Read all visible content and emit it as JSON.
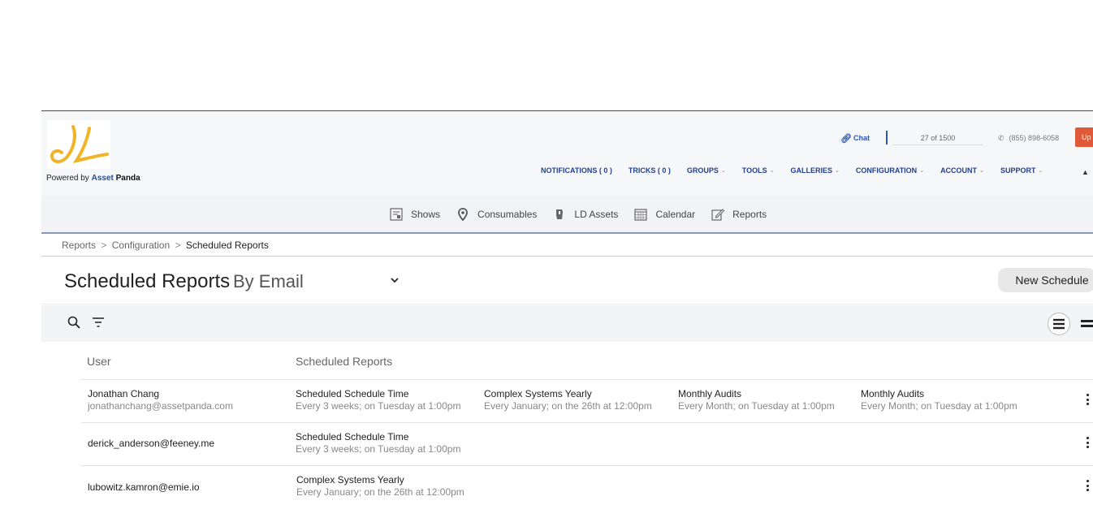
{
  "header": {
    "powered_prefix": "Powered by ",
    "powered_asset": "Asset",
    "powered_panda": "Panda",
    "chat_label": "Chat",
    "asset_count": "27 of 1500",
    "phone": "(855) 898-6058",
    "upgrade_label": "Up",
    "nav": [
      {
        "label": "NOTIFICATIONS ( 0 )",
        "has_menu": false
      },
      {
        "label": "TRICKS ( 0 )",
        "has_menu": false
      },
      {
        "label": "GROUPS",
        "has_menu": true
      },
      {
        "label": "TOOLS",
        "has_menu": true
      },
      {
        "label": "GALLERIES",
        "has_menu": true
      },
      {
        "label": "CONFIGURATION",
        "has_menu": true
      },
      {
        "label": "ACCOUNT",
        "has_menu": true
      },
      {
        "label": "SUPPORT",
        "has_menu": true
      }
    ],
    "logo_color": "#f0b429"
  },
  "subnav": [
    {
      "label": "Shows",
      "icon": "shows-icon"
    },
    {
      "label": "Consumables",
      "icon": "map-pin-icon"
    },
    {
      "label": "LD Assets",
      "icon": "asset-tag-icon"
    },
    {
      "label": "Calendar",
      "icon": "calendar-icon"
    },
    {
      "label": "Reports",
      "icon": "edit-icon"
    }
  ],
  "breadcrumb": {
    "items": [
      "Reports",
      "Configuration"
    ],
    "sep": ">",
    "current": "Scheduled Reports"
  },
  "page": {
    "title": "Scheduled Reports",
    "view_value": "By Email",
    "new_button": "New Schedule"
  },
  "table": {
    "col_user": "User",
    "col_reports": "Scheduled Reports",
    "rows": [
      {
        "name": "Jonathan Chang",
        "email": "jonathanchang@assetpanda.com",
        "reports": [
          {
            "name": "Scheduled Schedule Time",
            "schedule": "Every 3 weeks; on Tuesday at 1:00pm"
          },
          {
            "name": "Complex Systems Yearly",
            "schedule": "Every January; on the 26th at 12:00pm"
          },
          {
            "name": "Monthly Audits",
            "schedule": "Every Month; on Tuesday at 1:00pm"
          },
          {
            "name": "Monthly Audits",
            "schedule": "Every Month; on Tuesday at 1:00pm"
          }
        ]
      },
      {
        "name": "",
        "email": "derick_anderson@feeney.me",
        "reports": [
          {
            "name": "Scheduled Schedule Time",
            "schedule": "Every 3 weeks; on Tuesday at 1:00pm"
          }
        ]
      },
      {
        "name": "",
        "email": "lubowitz.kamron@emie.io",
        "reports": [
          {
            "name": "Complex Systems Yearly",
            "schedule": "Every January; on the 26th at 12:00pm"
          }
        ]
      }
    ]
  },
  "colors": {
    "nav_text": "#23408e",
    "upgrade": "#e05a3a",
    "accent": "#2b57b8"
  }
}
